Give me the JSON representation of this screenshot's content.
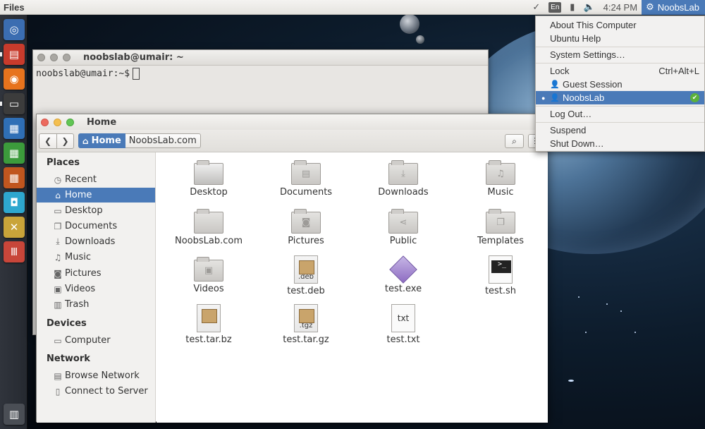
{
  "panel": {
    "app_title": "Files",
    "lang": "En",
    "time": "4:24 PM",
    "user": "NoobsLab"
  },
  "terminal": {
    "title": "noobslab@umair: ~",
    "prompt": "noobslab@umair:~$"
  },
  "files": {
    "title": "Home",
    "path_home": "Home",
    "path_segment": "NoobsLab.com",
    "sidebar": {
      "places_heading": "Places",
      "places": [
        {
          "label": "Recent",
          "icon": "clock-icon"
        },
        {
          "label": "Home",
          "icon": "home-icon"
        },
        {
          "label": "Desktop",
          "icon": "desktop-icon"
        },
        {
          "label": "Documents",
          "icon": "documents-icon"
        },
        {
          "label": "Downloads",
          "icon": "download-icon"
        },
        {
          "label": "Music",
          "icon": "music-icon"
        },
        {
          "label": "Pictures",
          "icon": "camera-icon"
        },
        {
          "label": "Videos",
          "icon": "film-icon"
        },
        {
          "label": "Trash",
          "icon": "trash-icon"
        }
      ],
      "devices_heading": "Devices",
      "devices": [
        {
          "label": "Computer",
          "icon": "computer-icon"
        }
      ],
      "network_heading": "Network",
      "network": [
        {
          "label": "Browse Network",
          "icon": "network-icon"
        },
        {
          "label": "Connect to Server",
          "icon": "server-icon"
        }
      ]
    },
    "items": [
      {
        "label": "Desktop",
        "kind": "folder"
      },
      {
        "label": "Documents",
        "kind": "folder"
      },
      {
        "label": "Downloads",
        "kind": "folder"
      },
      {
        "label": "Music",
        "kind": "folder"
      },
      {
        "label": "NoobsLab.com",
        "kind": "folder"
      },
      {
        "label": "Pictures",
        "kind": "folder"
      },
      {
        "label": "Public",
        "kind": "folder"
      },
      {
        "label": "Templates",
        "kind": "folder"
      },
      {
        "label": "Videos",
        "kind": "folder"
      },
      {
        "label": "test.deb",
        "kind": "deb",
        "badge": ".deb"
      },
      {
        "label": "test.exe",
        "kind": "exe"
      },
      {
        "label": "test.sh",
        "kind": "sh"
      },
      {
        "label": "test.tar.bz",
        "kind": "bz"
      },
      {
        "label": "test.tar.gz",
        "kind": "gz",
        "badge": ".tgz"
      },
      {
        "label": "test.txt",
        "kind": "txt",
        "badge": "txt"
      }
    ]
  },
  "user_menu": {
    "about": "About This Computer",
    "help": "Ubuntu Help",
    "settings": "System Settings…",
    "lock": "Lock",
    "lock_shortcut": "Ctrl+Alt+L",
    "guest": "Guest Session",
    "current_user": "NoobsLab",
    "logout": "Log Out…",
    "suspend": "Suspend",
    "shutdown": "Shut Down…"
  },
  "colors": {
    "accent": "#4a7ab8",
    "panel": "#ece9e6",
    "launcher": "#2b2f36"
  }
}
